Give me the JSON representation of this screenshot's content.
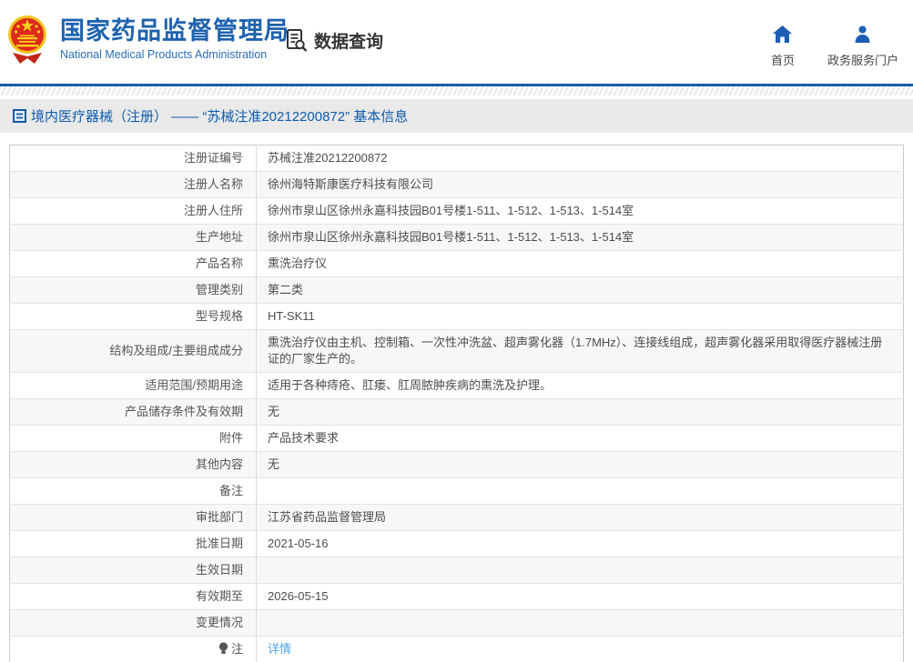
{
  "header": {
    "title": "国家药品监督管理局",
    "subtitle": "National Medical Products Administration",
    "query_label": "数据查询",
    "home_label": "首页",
    "portal_label": "政务服务门户"
  },
  "breadcrumb": {
    "text": "境内医疗器械（注册） —— “苏械注准20212200872” 基本信息"
  },
  "colors": {
    "brand_blue": "#1e62ae",
    "bar_blue": "#1560a8",
    "breadcrumb_blue": "#0d5cad",
    "icon_blue": "#1b5eb4",
    "link_blue": "#4da3e8",
    "emblem_red": "#dd2a1b",
    "emblem_gold": "#f0c41c"
  },
  "table": {
    "rows": [
      {
        "label": "注册证编号",
        "value": "苏械注准20212200872"
      },
      {
        "label": "注册人名称",
        "value": "徐州海特斯康医疗科技有限公司"
      },
      {
        "label": "注册人住所",
        "value": "徐州市泉山区徐州永嘉科技园B01号楼1-511、1-512、1-513、1-514室"
      },
      {
        "label": "生产地址",
        "value": "徐州市泉山区徐州永嘉科技园B01号楼1-511、1-512、1-513、1-514室"
      },
      {
        "label": "产品名称",
        "value": "熏洗治疗仪"
      },
      {
        "label": "管理类别",
        "value": "第二类"
      },
      {
        "label": "型号规格",
        "value": "HT-SK11"
      },
      {
        "label": "结构及组成/主要组成成分",
        "value": "熏洗治疗仪由主机、控制箱、一次性冲洗盆、超声雾化器（1.7MHz）、连接线组成，超声雾化器采用取得医疗器械注册证的厂家生产的。"
      },
      {
        "label": "适用范围/预期用途",
        "value": "适用于各种痔疮、肛瘘、肛周脓肿疾病的熏洗及护理。"
      },
      {
        "label": "产品储存条件及有效期",
        "value": "无"
      },
      {
        "label": "附件",
        "value": "产品技术要求"
      },
      {
        "label": "其他内容",
        "value": "无"
      },
      {
        "label": "备注",
        "value": ""
      },
      {
        "label": "审批部门",
        "value": "江苏省药品监督管理局"
      },
      {
        "label": "批准日期",
        "value": "2021-05-16"
      },
      {
        "label": "生效日期",
        "value": ""
      },
      {
        "label": "有效期至",
        "value": "2026-05-15"
      },
      {
        "label": "变更情况",
        "value": ""
      },
      {
        "label": "注",
        "label_icon": "bulb-icon",
        "value": "详情",
        "value_is_link": true
      }
    ]
  }
}
